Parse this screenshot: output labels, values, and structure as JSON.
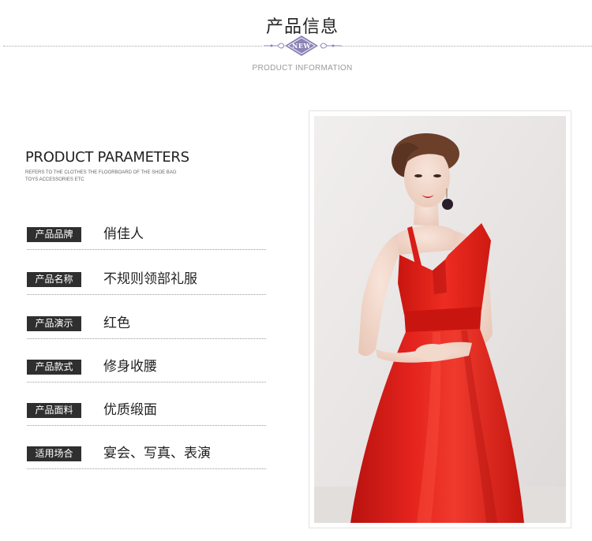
{
  "header": {
    "title": "产品信息",
    "badge": "NEW",
    "subtitle": "PRODUCT INFORMATION"
  },
  "parameters": {
    "title": "PRODUCT PARAMETERS",
    "description": "REFERS TO THE CLOTHES THE FLOORBOARD OF THE SHOE BAG TOYS ACCESSORIES ETC",
    "rows": [
      {
        "label": "产品品牌",
        "value": "俏佳人"
      },
      {
        "label": "产品名称",
        "value": "不规则领部礼服"
      },
      {
        "label": "产品演示",
        "value": "红色"
      },
      {
        "label": "产品款式",
        "value": "修身收腰"
      },
      {
        "label": "产品面料",
        "value": "优质缎面"
      },
      {
        "label": "适用场合",
        "value": "宴会、写真、表演"
      }
    ]
  },
  "colors": {
    "label_bg": "#2f2f2f",
    "badge": "#8b84b6",
    "dress": "#e0201c",
    "divider": "#9a9a9a"
  },
  "photo": {
    "subject": "model-in-red-asymmetric-dress"
  }
}
